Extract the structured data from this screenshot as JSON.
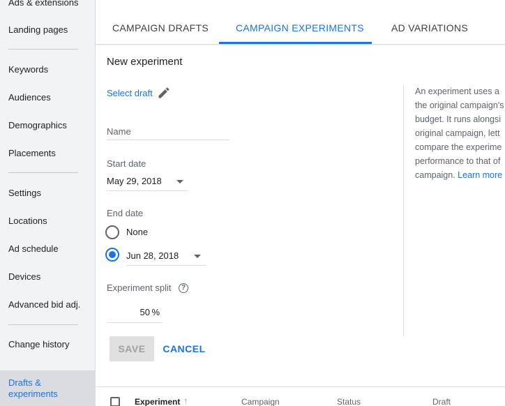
{
  "sidebar": {
    "items": [
      {
        "label": "Ads & extensions"
      },
      {
        "label": "Landing pages"
      },
      {
        "label": "Keywords"
      },
      {
        "label": "Audiences"
      },
      {
        "label": "Demographics"
      },
      {
        "label": "Placements"
      },
      {
        "label": "Settings"
      },
      {
        "label": "Locations"
      },
      {
        "label": "Ad schedule"
      },
      {
        "label": "Devices"
      },
      {
        "label": "Advanced bid adj."
      },
      {
        "label": "Change history"
      }
    ],
    "active_label": "Drafts & experiments"
  },
  "tabs": [
    {
      "label": "CAMPAIGN DRAFTS"
    },
    {
      "label": "CAMPAIGN EXPERIMENTS"
    },
    {
      "label": "AD VARIATIONS"
    }
  ],
  "form": {
    "title": "New experiment",
    "select_draft": "Select draft",
    "name_placeholder": "Name",
    "start_date_label": "Start date",
    "start_date_value": "May 29, 2018",
    "end_date_label": "End date",
    "end_none_label": "None",
    "end_date_value": "Jun 28, 2018",
    "split_label": "Experiment split",
    "split_value": "50",
    "split_unit": "%",
    "save_label": "SAVE",
    "cancel_label": "CANCEL"
  },
  "info": {
    "lines": [
      "An experiment uses a",
      "the original campaign's",
      "budget. It runs alongsi",
      "original campaign, lett",
      "compare the experime",
      "performance to that of"
    ],
    "last_line": "campaign.",
    "link": "Learn more"
  },
  "table": {
    "columns": [
      "Experiment",
      "Campaign",
      "Status",
      "Draft"
    ]
  },
  "colors": {
    "accent": "#1a73e8",
    "sidebar_bg": "#f1f3f4"
  }
}
